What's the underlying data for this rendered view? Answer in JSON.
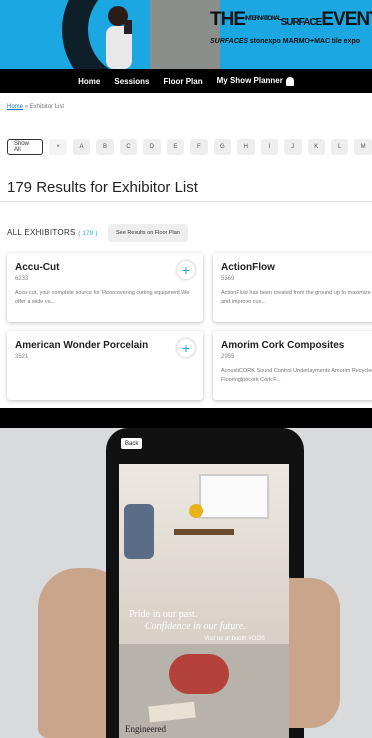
{
  "banner": {
    "event_the": "THE",
    "event_small": "INTERNATIONAL",
    "event_surface": "SURFACE",
    "event_word": "EVENT",
    "brands": [
      "SURFACES",
      "stonexpo MARMO+MAC",
      "tile expo"
    ]
  },
  "nav": {
    "items": [
      "Home",
      "Sessions",
      "Floor Plan",
      "My Show Planner"
    ],
    "bell_icon": "bell-icon"
  },
  "breadcrumb": {
    "home": "Home",
    "sep": "»",
    "current": "Exhibitor List"
  },
  "filter": {
    "show_all": "Show All",
    "clear": "×",
    "letters": [
      "A",
      "B",
      "C",
      "D",
      "E",
      "F",
      "G",
      "H",
      "I",
      "J",
      "K",
      "L",
      "M"
    ]
  },
  "results_title": "179 Results for Exhibitor List",
  "all_exhibitors": {
    "label": "ALL EXHIBITORS",
    "count": "( 179 )",
    "floor_button": "See Results on Floor Plan"
  },
  "exhibitors": [
    {
      "name": "Accu-Cut",
      "booth": "6233",
      "desc": "Accu-cut, your complete source for Floorcovering cutting equipment.We offer a wide va..."
    },
    {
      "name": "ActionFlow",
      "booth": "5369",
      "desc": "ActionFlow has been created from the ground up to maximize efficiency and improve cus..."
    },
    {
      "name": "American Wonder Porcelain",
      "booth": "3521",
      "desc": ""
    },
    {
      "name": "Amorim Cork Composites",
      "booth": "2955",
      "desc": "AcoustiCORK Sound Control Underlayments Amorim Recycled Rubber Flooringlpocork Cork F..."
    }
  ],
  "phone_ad": {
    "back_label": "Back",
    "line1": "Pride in our past.",
    "line2": "Confidence in our future.",
    "line3": "Visit us at booth #OOS",
    "bottom_text": "Engineered"
  },
  "colors": {
    "banner_blue": "#1aa7e2",
    "accent": "#1aa7e2",
    "nav_bg": "#000000"
  }
}
